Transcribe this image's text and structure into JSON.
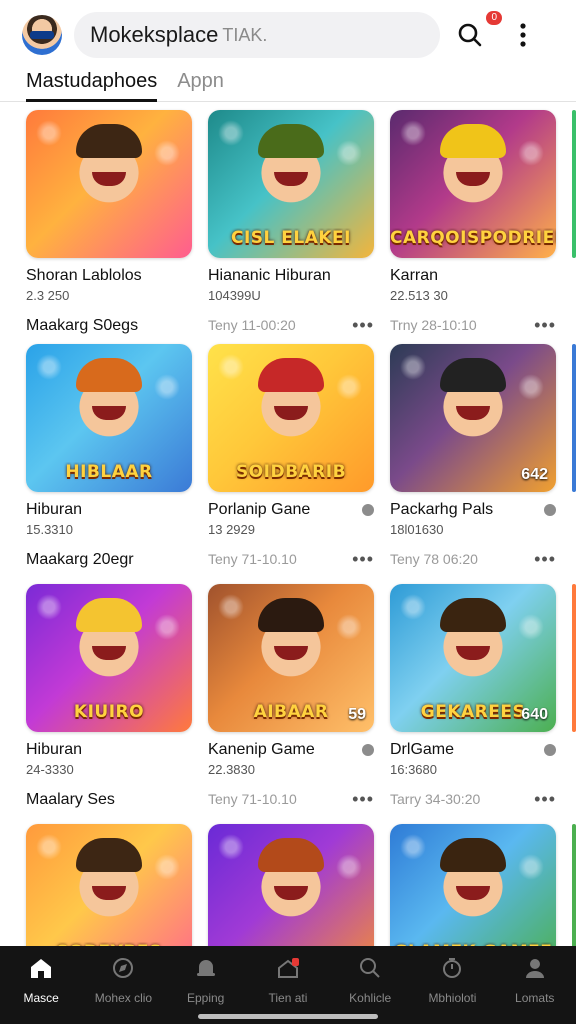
{
  "header": {
    "search_text": "Mokeksplace",
    "search_hint": "TIAK.",
    "notification_badge": "0"
  },
  "tabs": [
    {
      "label": "Mastudaphoes",
      "active": true
    },
    {
      "label": "Appn",
      "active": false
    }
  ],
  "sections": [
    {
      "label": "Maakarg S0egs"
    },
    {
      "label": "Maakarg 20egr"
    },
    {
      "label": "Maalary Ses"
    }
  ],
  "cards": [
    {
      "thumb_text": "",
      "title": "Shoran Lablolos",
      "sub": "2.3 250",
      "meta": "Maakarg S0egs",
      "meta_style": "dark",
      "bg": "linear-gradient(135deg,#ff7a3c,#ffb23f 45%,#ff5d8f)",
      "hair": "#3d2614"
    },
    {
      "thumb_text": "CISL ELAKEI",
      "title": "Hiananic Hiburan",
      "sub": "104399U",
      "meta": "Teny 11-00:20",
      "meta_style": "light",
      "bg": "linear-gradient(135deg,#1e8a8a,#46c2c7 45%,#f3b53c)",
      "hair": "#4a6b1a"
    },
    {
      "thumb_text": "CARQOISPODRIEL",
      "title": "Karran",
      "sub": "22.513 30",
      "meta": "Trny 28-10:10",
      "meta_style": "light",
      "bg": "linear-gradient(135deg,#5a2a6e,#b23a8a 45%,#ffb04a)",
      "hair": "#f0c419"
    },
    {
      "thumb_text": "HIBLAAR",
      "title": "Hiburan",
      "sub": "15.3310",
      "meta": "Maakarg 20egr",
      "meta_style": "dark",
      "bg": "linear-gradient(135deg,#2aa2e8,#5cc6f0 45%,#3b7ad6)",
      "hair": "#d86a1c"
    },
    {
      "thumb_text": "SOIDBARIB",
      "title": "Porlanip Gane",
      "sub": "13 2929",
      "meta": "Teny 71-10.10",
      "meta_style": "light",
      "bg": "linear-gradient(135deg,#ffe24a,#ffc83a 45%,#ff9a2a)",
      "hair": "#c62828"
    },
    {
      "thumb_text": "",
      "thumb_num": "642",
      "title": "Packarhg Pals",
      "sub": "18l01630",
      "meta": "Teny 78 06:20",
      "meta_style": "light",
      "bg": "linear-gradient(135deg,#2c3b55,#7a4a8a 45%,#f0a030)",
      "hair": "#222222"
    },
    {
      "thumb_text": "KIUIRO",
      "title": "Hiburan",
      "sub": "24-3330",
      "meta": "Maalary Ses",
      "meta_style": "dark",
      "bg": "linear-gradient(135deg,#7b2ad6,#c23ad6 45%,#ff7a3c)",
      "hair": "#f4c430"
    },
    {
      "thumb_text": "AIBAAR",
      "thumb_num": "59",
      "title": "Kanenip Game",
      "sub": "22.3830",
      "meta": "Teny 71-10.10",
      "meta_style": "light",
      "bg": "linear-gradient(135deg,#a0522d,#e8893c 45%,#ffc06a)",
      "hair": "#2b1a10"
    },
    {
      "thumb_text": "GEKAREES",
      "thumb_num": "640",
      "title": "DrlGame",
      "sub": "16:3680",
      "meta": "Tarry 34-30:20",
      "meta_style": "light",
      "bg": "linear-gradient(135deg,#2e9bd6,#7fd0f0 45%,#4caf50)",
      "hair": "#3a2410"
    },
    {
      "thumb_text": "SODEYBES",
      "title": "",
      "sub": "",
      "meta": "",
      "meta_style": "light",
      "bg": "linear-gradient(135deg,#ff9a3c,#ffc84a 45%,#ff6a8a)",
      "hair": "#3d2614"
    },
    {
      "thumb_text": "",
      "title": "",
      "sub": "",
      "meta": "",
      "meta_style": "light",
      "bg": "linear-gradient(135deg,#6a2ad6,#a03ad6 45%,#f08a3c)",
      "hair": "#b34a1a"
    },
    {
      "thumb_text": "GLAMEK GAMEE",
      "title": "",
      "sub": "",
      "meta": "",
      "meta_style": "light",
      "bg": "linear-gradient(135deg,#2e7bd6,#5ab8f0 45%,#4caf50)",
      "hair": "#3a2410"
    }
  ],
  "nav": [
    {
      "label": "Masce",
      "icon": "home-icon",
      "active": true
    },
    {
      "label": "Mohex clio",
      "icon": "compass-icon",
      "active": false
    },
    {
      "label": "Epping",
      "icon": "bell-icon",
      "active": false
    },
    {
      "label": "Tien ati",
      "icon": "cart-icon",
      "active": false
    },
    {
      "label": "Kohlicle",
      "icon": "search-icon",
      "active": false
    },
    {
      "label": "Mbhioloti",
      "icon": "clock-icon",
      "active": false
    },
    {
      "label": "Lomats",
      "icon": "profile-icon",
      "active": false
    }
  ],
  "colors": {
    "accent": "#111111",
    "badge": "#e53935",
    "nav_bg": "#141414"
  }
}
